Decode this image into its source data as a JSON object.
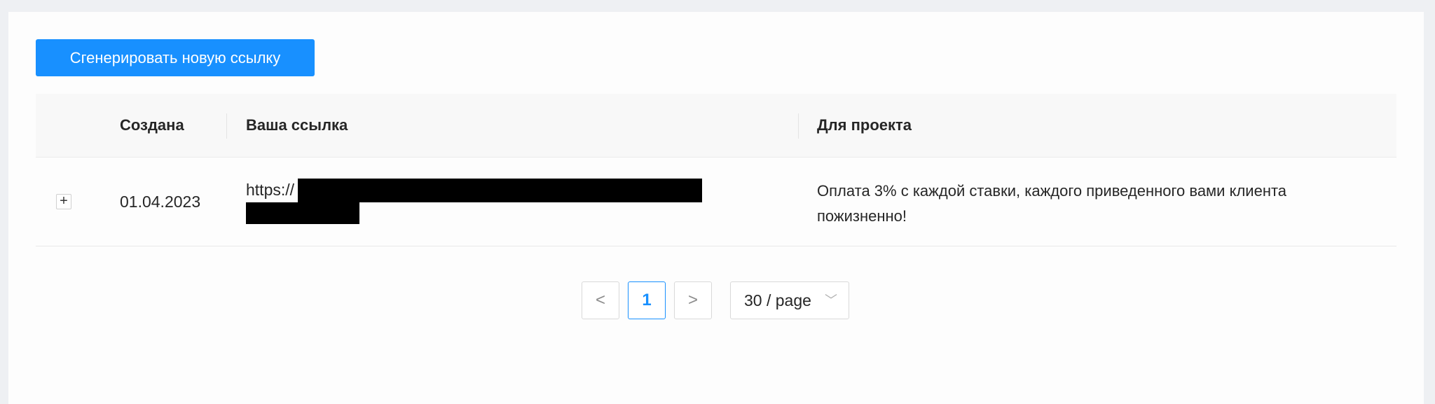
{
  "toolbar": {
    "generate_label": "Сгенерировать новую ссылку"
  },
  "table": {
    "columns": [
      "Создана",
      "Ваша ссылка",
      "Для проекта"
    ],
    "rows": [
      {
        "expand_symbol": "+",
        "created": "01.04.2023",
        "link_prefix": "https://",
        "project": "Оплата 3% с каждой ставки, каждого приведенного вами клиента пожизненно!"
      }
    ]
  },
  "pagination": {
    "prev_symbol": "<",
    "current_page": "1",
    "next_symbol": ">",
    "page_size_label": "30 / page",
    "dropdown_symbol": "﹀"
  },
  "colors": {
    "accent": "#1890ff",
    "background": "#eef0f3",
    "header": "#f8f8f8"
  }
}
